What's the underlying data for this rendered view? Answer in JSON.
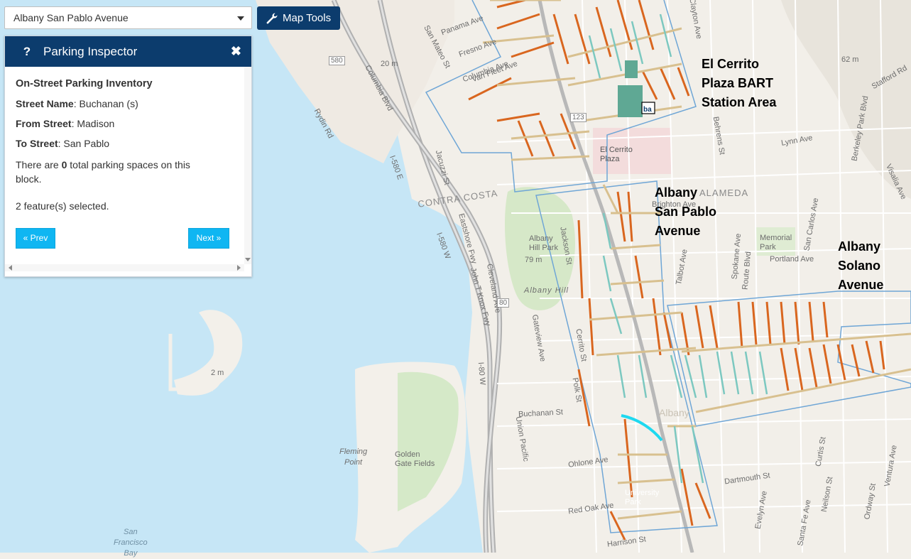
{
  "header": {
    "area_select_value": "Albany San Pablo Avenue",
    "map_tools_label": "Map Tools"
  },
  "panel": {
    "title": "Parking Inspector",
    "heading": "On-Street Parking Inventory",
    "street_name_label": "Street Name",
    "street_name_value": ": Buchanan (s)",
    "from_street_label": "From Street",
    "from_street_value": ": Madison",
    "to_street_label": "To Street",
    "to_street_value": ": San Pablo",
    "msg_prefix": "There are ",
    "msg_count": "0",
    "msg_suffix": " total parking spaces on this block.",
    "selected_text": "2 feature(s) selected.",
    "prev_label": "« Prev",
    "next_label": "Next »"
  },
  "map": {
    "area_labels": [
      "El Cerrito\nPlaza BART\nStation Area",
      "Albany\nSan Pablo\nAvenue",
      "Albany\nSolano\nAvenue"
    ],
    "place_labels": {
      "el_cerrito_plaza": "El Cerrito\nPlaza",
      "contra_costa": "CONTRA COSTA",
      "alameda": "ALAMEDA",
      "albany_hill_park": "Albany\nHill Park",
      "albany_hill": "Albany Hill",
      "memorial_park": "Memorial\nPark",
      "golden_gate_fields": "Golden\nGate Fields",
      "fleming_point": "Fleming\nPoint",
      "san_francisco_bay": "San\nFrancisco\nBay",
      "university_park": "University\nPark",
      "albany": "Albany"
    },
    "elevations": [
      "20 m",
      "79 m",
      "2 m",
      "62 m"
    ],
    "streets": [
      "Panama Ave",
      "Fresno Ave",
      "Columbia Ave",
      "Van Fleet Ave",
      "San Mateo St",
      "Columbia Blvd",
      "Rydin Rd",
      "Buchanan St",
      "Solano Ave",
      "Portland Ave",
      "Lynn Ave",
      "Dartmouth St",
      "Ohlone Ave",
      "Harrison St",
      "Red Oak Ave",
      "Stafford Rd",
      "Clayton Ave",
      "Behrens St",
      "Spokane Ave",
      "Gateview Ave",
      "Cleveland Ave",
      "Eastshore Fwy",
      "John T Knox Fwy",
      "Jacuzzi St",
      "Jackson St",
      "Cerrito St",
      "Polk St",
      "Talbot Ave",
      "Evelyn Ave",
      "Santa Fe Ave",
      "Curtis St",
      "Ordway St",
      "Ventura Ave",
      "Neilson St",
      "Visalia Ave",
      "Berkeley Park Blvd",
      "San Carlos Ave",
      "Union Pacific",
      "Brighton Ave",
      "Route Blvd"
    ],
    "highways": [
      "580",
      "80",
      "I-580 E",
      "I-580 W",
      "I-80 W",
      "123"
    ]
  }
}
